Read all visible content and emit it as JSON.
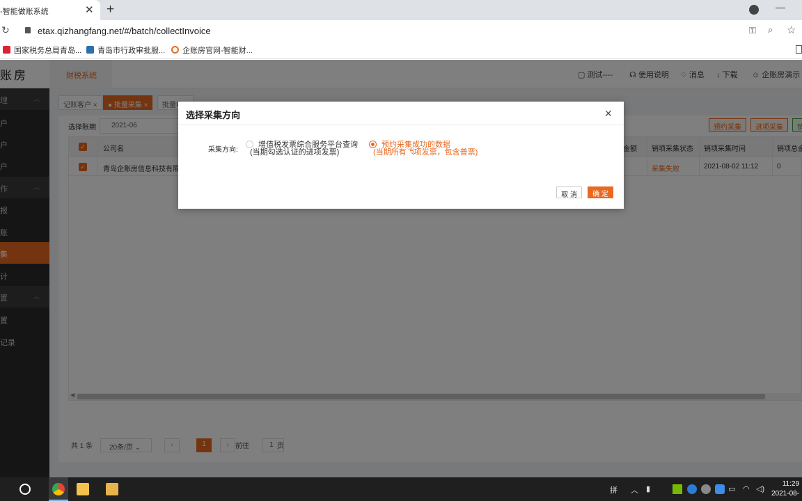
{
  "browser": {
    "tab_title": "-智能做账系统",
    "url": "etax.qizhangfang.net/#/batch/collectInvoice",
    "bookmarks": [
      "国家税务总局青岛...",
      "青岛市行政审批服...",
      "企账房官网-智能财..."
    ]
  },
  "app": {
    "logo": "账房",
    "header_nav": "财税系统",
    "header_links": {
      "test": "测试----",
      "help": "使用说明",
      "messages": "消息",
      "download": "下载",
      "user": "企账房演示"
    },
    "sidebar": [
      {
        "label": "理",
        "type": "group"
      },
      {
        "label": "户",
        "type": "item"
      },
      {
        "label": "户",
        "type": "item"
      },
      {
        "label": "户",
        "type": "item"
      },
      {
        "label": "作",
        "type": "group"
      },
      {
        "label": "报",
        "type": "item"
      },
      {
        "label": "账",
        "type": "item"
      },
      {
        "label": "集",
        "type": "active"
      },
      {
        "label": "计",
        "type": "item"
      },
      {
        "label": "置",
        "type": "group"
      },
      {
        "label": "置",
        "type": "item"
      },
      {
        "label": "记录",
        "type": "item"
      }
    ],
    "page_tabs": [
      "记账客户 ×",
      "● 批量采集 ×",
      "批量申..."
    ],
    "filter": {
      "label": "选择账期",
      "period": "2021-06"
    },
    "buttons": {
      "reserve": "预约采集",
      "input": "进项采集",
      "output": "销"
    },
    "table": {
      "columns": [
        "公司名",
        "金额",
        "销项采集状态",
        "销项采集时间",
        "销项总金"
      ],
      "rows": [
        {
          "company": "青岛企账房信息科技有限...",
          "status": "采集失败",
          "time": "2021-08-02 11:12",
          "total": "0"
        }
      ]
    },
    "pager": {
      "total": "共 1 条",
      "page_size": "20条/页",
      "current": "1",
      "goto_label": "前往",
      "goto_value": "1",
      "page_suffix": "页"
    }
  },
  "dialog": {
    "title": "选择采集方向",
    "field_label": "采集方向:",
    "option_a_line1": "增值税发票综合服务平台查询",
    "option_a_line2": "(当期勾选认证的进项发票)",
    "option_b_line1": "预约采集成功的数据",
    "option_b_line2": "(当期所有销项发票，包含普票)",
    "selected": "option_b",
    "cancel": "取 消",
    "confirm": "确 定"
  },
  "taskbar": {
    "clock_time": "11:29",
    "clock_date": "2021-08-"
  },
  "colors": {
    "accent": "#e8691f",
    "sidebar_bg": "#2b2b2b",
    "taskbar_bg": "#1f1f1f"
  }
}
